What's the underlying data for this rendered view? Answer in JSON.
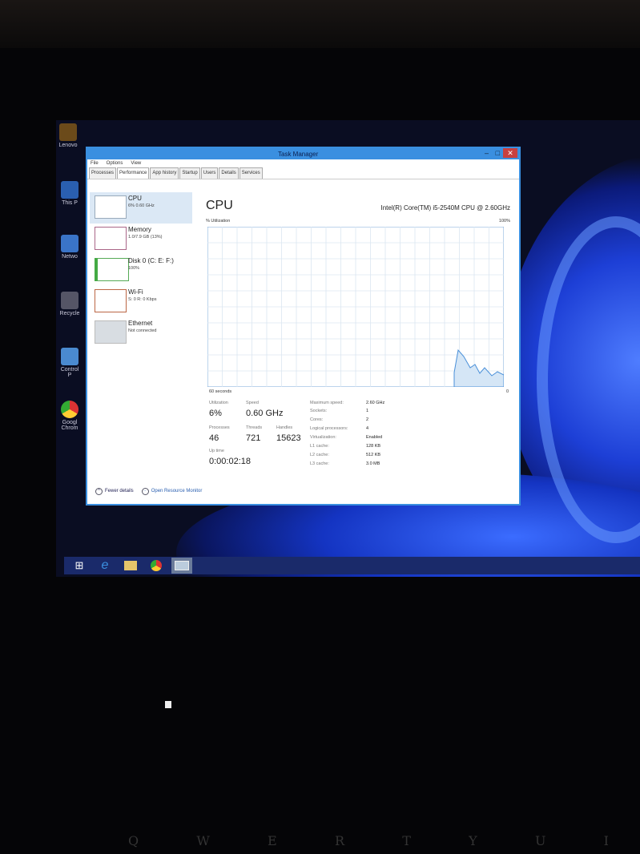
{
  "desktop": {
    "icons": [
      {
        "label": "Lenovo",
        "icon": "app-icon"
      },
      {
        "label": "This P",
        "icon": "this-pc-icon"
      },
      {
        "label": "Netwo",
        "icon": "network-icon"
      },
      {
        "label": "Recycle",
        "icon": "recycle-bin-icon"
      },
      {
        "label": "Control P",
        "icon": "control-panel-icon"
      },
      {
        "label": "Googl Chrom",
        "icon": "chrome-icon"
      }
    ]
  },
  "taskbar": {
    "items": [
      "windows-start-icon",
      "internet-explorer-icon",
      "file-explorer-icon",
      "chrome-icon",
      "task-manager-icon"
    ]
  },
  "window": {
    "title": "Task Manager",
    "menu": [
      "File",
      "Options",
      "View"
    ],
    "tabs": [
      "Processes",
      "Performance",
      "App history",
      "Startup",
      "Users",
      "Details",
      "Services"
    ],
    "selected_tab": "Performance"
  },
  "sidebar": {
    "items": [
      {
        "name": "CPU",
        "sub": "6% 0.60 GHz"
      },
      {
        "name": "Memory",
        "sub": "1.0/7.9 GB (13%)"
      },
      {
        "name": "Disk 0 (C: E: F:)",
        "sub": "100%"
      },
      {
        "name": "Wi-Fi",
        "sub": "S: 0 R: 0 Kbps"
      },
      {
        "name": "Ethernet",
        "sub": "Not connected"
      }
    ]
  },
  "cpu_panel": {
    "heading": "CPU",
    "model": "Intel(R) Core(TM) i5-2540M CPU @ 2.60GHz",
    "util_label": "% Utilization",
    "util_max": "100%",
    "time_label": "60 seconds",
    "zero": "0",
    "stats": {
      "utilization_label": "Utilization",
      "utilization": "6%",
      "speed_label": "Speed",
      "speed": "0.60 GHz",
      "processes_label": "Processes",
      "processes": "46",
      "threads_label": "Threads",
      "threads": "721",
      "handles_label": "Handles",
      "handles": "15623",
      "uptime_label": "Up time",
      "uptime": "0:00:02:18"
    },
    "details": [
      {
        "k": "Maximum speed:",
        "v": "2.60 GHz"
      },
      {
        "k": "Sockets:",
        "v": "1"
      },
      {
        "k": "Cores:",
        "v": "2"
      },
      {
        "k": "Logical processors:",
        "v": "4"
      },
      {
        "k": "Virtualization:",
        "v": "Enabled"
      },
      {
        "k": "L1 cache:",
        "v": "128 KB"
      },
      {
        "k": "L2 cache:",
        "v": "512 KB"
      },
      {
        "k": "L3 cache:",
        "v": "3.0 MB"
      }
    ]
  },
  "footer": {
    "fewer_details": "Fewer details",
    "open_monitor": "Open Resource Monitor"
  },
  "keyboard_keys": [
    "Q",
    "W",
    "E",
    "R",
    "T",
    "Y",
    "U",
    "I"
  ],
  "colors": {
    "accent": "#3a8fe0",
    "graph_line": "#4a90d9",
    "graph_fill": "#d5e6f6"
  }
}
